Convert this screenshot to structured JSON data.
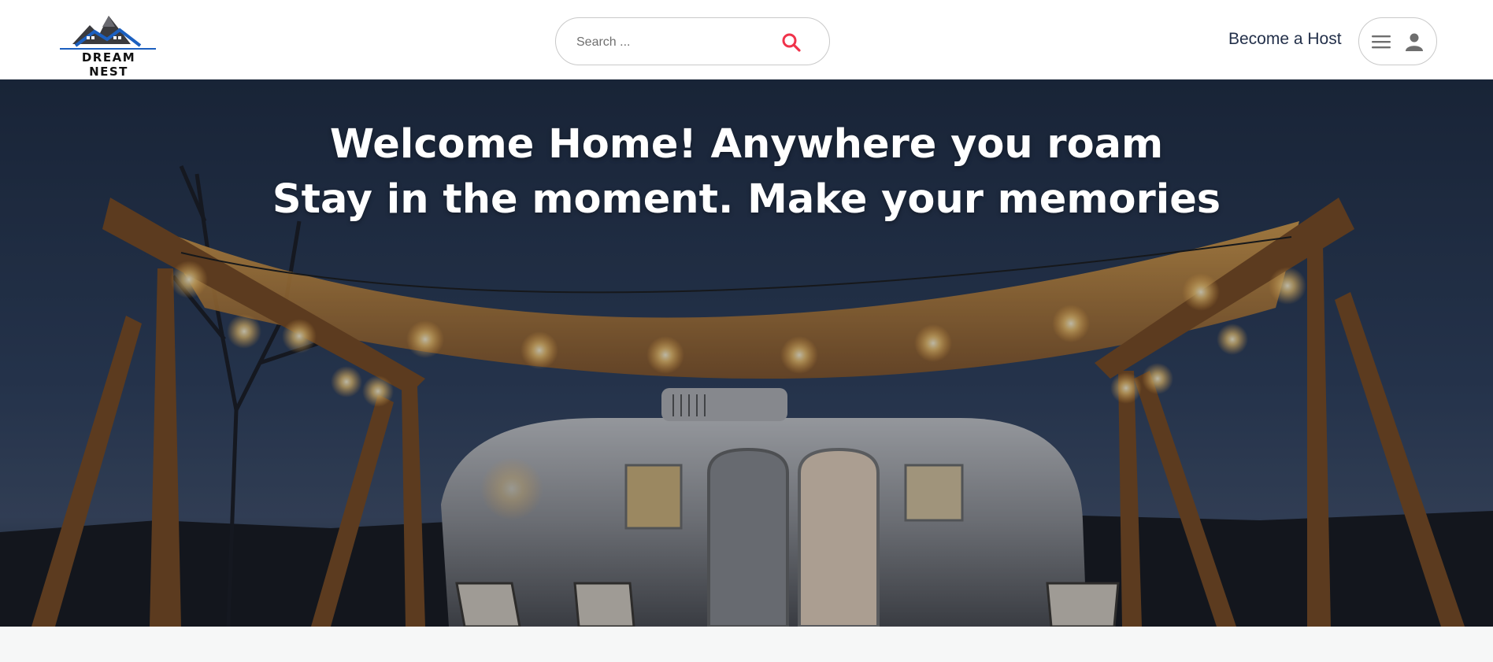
{
  "brand": {
    "name": "DREAM NEST",
    "accent_color": "#1b5fbf"
  },
  "search": {
    "placeholder": "Search ...",
    "value": "",
    "icon": "search-icon",
    "icon_color": "#f0334b"
  },
  "nav": {
    "host_label": "Become a Host",
    "menu_icon": "hamburger-icon",
    "user_icon": "person-icon"
  },
  "hero": {
    "line1": "Welcome Home! Anywhere you roam",
    "line2": "Stay in the moment. Make your memories"
  }
}
